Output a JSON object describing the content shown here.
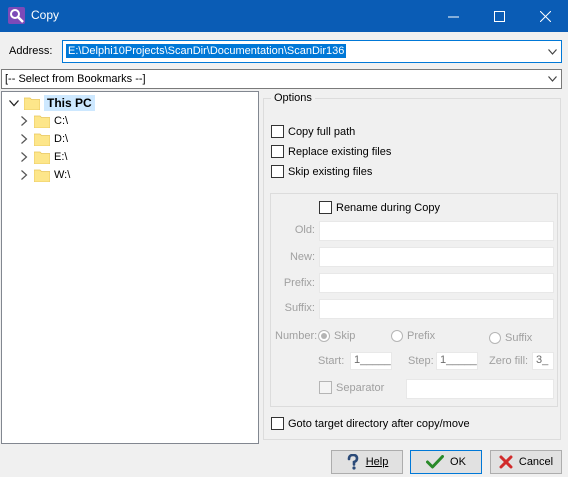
{
  "window": {
    "title": "Copy"
  },
  "address": {
    "label": "Address:",
    "value": "E:\\Delphi10Projects\\ScanDir\\Documentation\\ScanDir136"
  },
  "bookmarks": {
    "value": "[-- Select from Bookmarks --]"
  },
  "tree": {
    "root": "This PC",
    "items": [
      "C:\\",
      "D:\\",
      "E:\\",
      "W:\\"
    ]
  },
  "options": {
    "legend": "Options",
    "copy_full_path": "Copy full path",
    "replace_existing": "Replace existing files",
    "skip_existing": "Skip existing files",
    "rename_during_copy": "Rename during Copy",
    "old_label": "Old:",
    "new_label": "New:",
    "prefix_label": "Prefix:",
    "suffix_label": "Suffix:",
    "number_label": "Number:",
    "radio_skip": "Skip",
    "radio_prefix": "Prefix",
    "radio_suffix": "Suffix",
    "start_label": "Start:",
    "start_value": "1_____",
    "step_label": "Step:",
    "step_value": "1_____",
    "zerofill_label": "Zero fill:",
    "zerofill_value": "3_",
    "separator_label": "Separator",
    "goto_target": "Goto target directory after copy/move"
  },
  "buttons": {
    "help": "Help",
    "ok": "OK",
    "cancel": "Cancel"
  },
  "colors": {
    "titlebar": "#0a5cb5",
    "selection": "#0078d7",
    "ok_check": "#2a8a2a",
    "cancel_x": "#d12b2b"
  }
}
